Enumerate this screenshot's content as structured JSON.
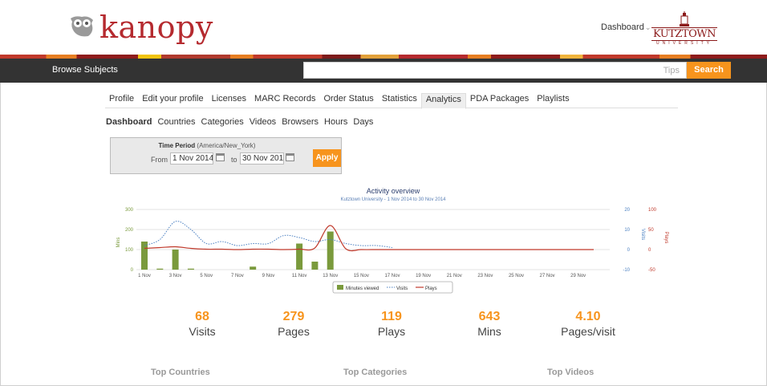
{
  "header": {
    "logo_text": "kanopy",
    "dashboard_link": "Dashboard",
    "institution_name": "KUTZTOWN",
    "institution_sub": "UNIVERSITY"
  },
  "navbar": {
    "browse": "Browse Subjects",
    "search_placeholder": "",
    "tips": "Tips",
    "search_button": "Search"
  },
  "tabs": [
    {
      "label": "Profile",
      "active": false
    },
    {
      "label": "Edit your profile",
      "active": false
    },
    {
      "label": "Licenses",
      "active": false
    },
    {
      "label": "MARC Records",
      "active": false
    },
    {
      "label": "Order Status",
      "active": false
    },
    {
      "label": "Statistics",
      "active": false
    },
    {
      "label": "Analytics",
      "active": true
    },
    {
      "label": "PDA Packages",
      "active": false
    },
    {
      "label": "Playlists",
      "active": false
    }
  ],
  "subtabs": [
    {
      "label": "Dashboard",
      "active": true
    },
    {
      "label": "Countries",
      "active": false
    },
    {
      "label": "Categories",
      "active": false
    },
    {
      "label": "Videos",
      "active": false
    },
    {
      "label": "Browsers",
      "active": false
    },
    {
      "label": "Hours",
      "active": false
    },
    {
      "label": "Days",
      "active": false
    }
  ],
  "period": {
    "title": "Time Period",
    "timezone": "(America/New_York)",
    "from_label": "From",
    "from_value": "1 Nov 2014",
    "to_label": "to",
    "to_value": "30 Nov 201",
    "apply": "Apply"
  },
  "chart_data": {
    "type": "bar",
    "title": "Activity overview",
    "subtitle": "Kutztown University - 1 Nov 2014 to 30 Nov 2014",
    "x": [
      "1 Nov",
      "2 Nov",
      "3 Nov",
      "4 Nov",
      "5 Nov",
      "6 Nov",
      "7 Nov",
      "8 Nov",
      "9 Nov",
      "10 Nov",
      "11 Nov",
      "12 Nov",
      "13 Nov",
      "14 Nov",
      "15 Nov",
      "16 Nov",
      "17 Nov",
      "18 Nov",
      "19 Nov",
      "20 Nov",
      "21 Nov",
      "22 Nov",
      "23 Nov",
      "24 Nov",
      "25 Nov",
      "26 Nov",
      "27 Nov",
      "28 Nov",
      "29 Nov",
      "30 Nov"
    ],
    "xtick_labels": [
      "1 Nov",
      "3 Nov",
      "5 Nov",
      "7 Nov",
      "9 Nov",
      "11 Nov",
      "13 Nov",
      "15 Nov",
      "17 Nov",
      "19 Nov",
      "21 Nov",
      "23 Nov",
      "25 Nov",
      "27 Nov",
      "29 Nov"
    ],
    "series": [
      {
        "name": "Minutes viewed",
        "axis": "left",
        "color": "#7a9a3c",
        "values": [
          140,
          5,
          100,
          5,
          0,
          0,
          0,
          15,
          0,
          0,
          130,
          40,
          190,
          0,
          0,
          0,
          0,
          0,
          0,
          0,
          0,
          0,
          0,
          0,
          0,
          0,
          0,
          0,
          0,
          0
        ]
      },
      {
        "name": "Visits",
        "axis": "right1",
        "color": "#4a7fc1",
        "values": [
          2,
          5,
          14,
          10,
          3,
          4,
          2,
          3,
          3,
          7,
          6,
          4,
          5,
          3,
          2,
          2,
          1,
          0,
          0,
          0,
          0,
          0,
          0,
          0,
          0,
          0,
          0,
          0,
          0,
          0
        ]
      },
      {
        "name": "Plays",
        "axis": "right2",
        "color": "#c0392b",
        "values": [
          3,
          5,
          7,
          3,
          1,
          1,
          0,
          1,
          1,
          0,
          1,
          4,
          60,
          2,
          0,
          0,
          0,
          0,
          0,
          0,
          0,
          0,
          0,
          0,
          0,
          0,
          0,
          0,
          0,
          0
        ]
      }
    ],
    "axes": {
      "left": {
        "label": "Mins",
        "ticks": [
          "300",
          "200",
          "100",
          "0"
        ],
        "ylim": [
          0,
          300
        ]
      },
      "right1": {
        "label": "Visits",
        "ticks": [
          "20",
          "10",
          "0",
          "-10"
        ],
        "ylim": [
          -10,
          20
        ]
      },
      "right2": {
        "label": "Plays",
        "ticks": [
          "100",
          "50",
          "0",
          "-50"
        ],
        "ylim": [
          -50,
          100
        ]
      }
    },
    "legend_position": "bottom-center"
  },
  "stats": [
    {
      "value": "68",
      "label": "Visits"
    },
    {
      "value": "279",
      "label": "Pages"
    },
    {
      "value": "119",
      "label": "Plays"
    },
    {
      "value": "643",
      "label": "Mins"
    },
    {
      "value": "4.10",
      "label": "Pages/visit"
    }
  ],
  "sections": {
    "top_countries": "Top Countries",
    "top_categories": "Top Categories",
    "top_videos": "Top Videos"
  },
  "colors": {
    "accent": "#f7941d",
    "brand": "#b52a2f",
    "navbar": "#333333"
  }
}
